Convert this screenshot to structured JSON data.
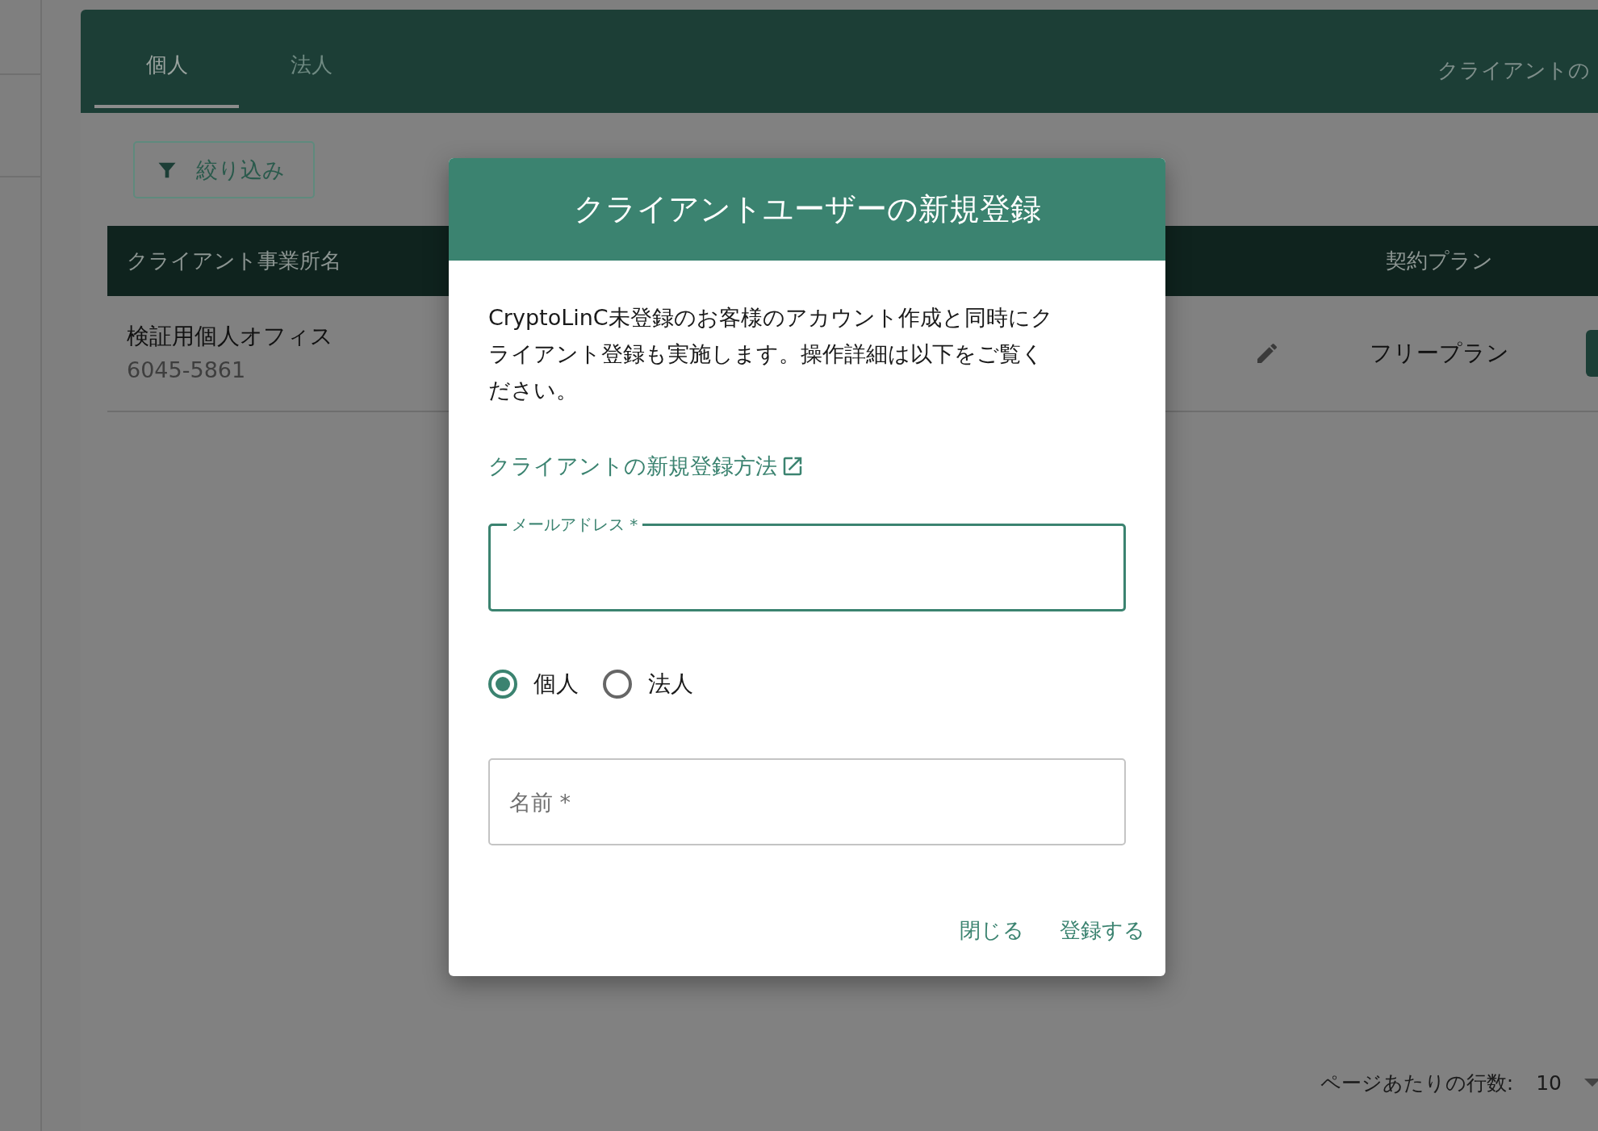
{
  "main": {
    "tabs": [
      {
        "label": "個人",
        "selected": true
      },
      {
        "label": "法人",
        "selected": false
      }
    ],
    "header_link": "クライアントの",
    "filter_button": "絞り込み",
    "table": {
      "columns": [
        "クライアント事業所名",
        "契約プラン"
      ],
      "rows": [
        {
          "office_name": "検証用個人オフィス",
          "office_id": "6045-5861",
          "plan": "フリープラン"
        }
      ]
    },
    "pagination": {
      "rows_per_page_label": "ページあたりの行数:",
      "rows_per_page": "10"
    }
  },
  "dialog": {
    "title": "クライアントユーザーの新規登録",
    "description": "CryptoLinC未登録のお客様のアカウント作成と同時にクライアント登録も実施します。操作詳細は以下をご覧ください。",
    "help_link": "クライアントの新規登録方法",
    "email_field": {
      "label": "メールアドレス *",
      "focused": true
    },
    "account_types": [
      {
        "label": "個人",
        "selected": true
      },
      {
        "label": "法人",
        "selected": false
      }
    ],
    "name_field": {
      "placeholder": "名前 *"
    },
    "buttons": [
      "閉じる",
      "登録する"
    ]
  }
}
